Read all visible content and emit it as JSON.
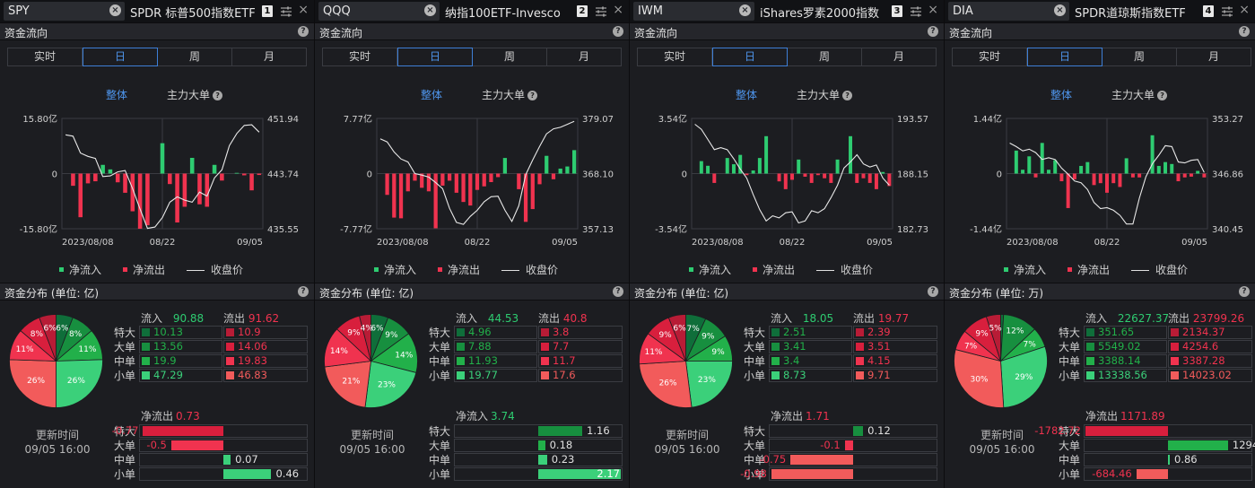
{
  "labels": {
    "section_flow": "资金流向",
    "section_dist_prefix": "资金分布 (单位: ",
    "tabs": [
      "实时",
      "日",
      "周",
      "月"
    ],
    "mode_all": "整体",
    "mode_main": "主力大单",
    "legend_in": "净流入",
    "legend_out": "净流出",
    "legend_close": "收盘价",
    "flow_in": "流入",
    "flow_out": "流出",
    "rows": [
      "特大",
      "大单",
      "中单",
      "小单"
    ],
    "update_time_label": "更新时间",
    "help": "?",
    "close": "×",
    "dates": [
      "2023/08/08",
      "08/22",
      "09/05"
    ]
  },
  "colors": {
    "inflow": "#2ecc71",
    "outflow": "#f0334f",
    "in_shades": [
      "#0f6e3a",
      "#178f3f",
      "#22b04a",
      "#3bd07a"
    ],
    "out_shades": [
      "#b81c36",
      "#d81f3d",
      "#f0334f",
      "#f25b5b"
    ],
    "accent": "#4e95ec"
  },
  "panels": [
    {
      "symbol": "SPY",
      "name": "SPDR 标普500指数ETF",
      "index": "1",
      "unit": "亿",
      "unit_suffix": ")",
      "chart_data": {
        "type": "bar",
        "series": [
          {
            "name": "净流入 / 净流出",
            "values": [
              0,
              -3.5,
              -12.5,
              -2.8,
              -2.2,
              2.5,
              1.2,
              -2.5,
              -5.5,
              -10.8,
              -15.8,
              -14.8,
              0,
              8.7,
              -3.0,
              -14.0,
              -9.5,
              4.5,
              -8.8,
              -9.5,
              2.5,
              -2.0,
              0,
              0.2,
              -0.5,
              -4.8,
              -0.4
            ]
          },
          {
            "name": "收盘价",
            "values": [
              449.5,
              449.3,
              446.8,
              446.3,
              446.0,
              443.3,
              443.4,
              444.0,
              444.2,
              441.5,
              438.5,
              435.6,
              435.8,
              437.2,
              439.5,
              440.3,
              439.8,
              439.5,
              441.0,
              440.4,
              443.1,
              444.3,
              447.9,
              449.7,
              450.9,
              451.0,
              449.9
            ]
          }
        ],
        "y_left": [
          "15.80亿",
          "0",
          "-15.80亿"
        ],
        "y_right": [
          "451.94",
          "443.74",
          "435.55"
        ],
        "y_range": [
          -15.8,
          15.8
        ],
        "price_range": [
          435.55,
          451.94
        ],
        "x_labels": [
          "2023/08/08",
          "08/22",
          "09/05"
        ]
      },
      "flow": {
        "in_total": "90.88",
        "out_total": "91.62",
        "in": [
          "10.13",
          "13.56",
          "19.9",
          "47.29"
        ],
        "out": [
          "10.9",
          "14.06",
          "19.83",
          "46.83"
        ]
      },
      "pie": [
        {
          "label": "6%",
          "value": 6,
          "side": "in",
          "shade": 0
        },
        {
          "label": "8%",
          "value": 8,
          "side": "in",
          "shade": 1
        },
        {
          "label": "11%",
          "value": 11,
          "side": "in",
          "shade": 2
        },
        {
          "label": "26%",
          "value": 26,
          "side": "in",
          "shade": 3
        },
        {
          "label": "26%",
          "value": 26,
          "side": "out",
          "shade": 3
        },
        {
          "label": "11%",
          "value": 11,
          "side": "out",
          "shade": 2
        },
        {
          "label": "8%",
          "value": 8,
          "side": "out",
          "shade": 1
        },
        {
          "label": "6%",
          "value": 6,
          "side": "out",
          "shade": 0
        }
      ],
      "net": {
        "title": "净流出",
        "total": "0.73",
        "dir": "out",
        "values": [
          -0.77,
          -0.5,
          0.07,
          0.46
        ],
        "labels": [
          "-0.77",
          "-0.5",
          "0.07",
          "0.46"
        ],
        "max": 0.8
      },
      "update_time": "09/05 16:00"
    },
    {
      "symbol": "QQQ",
      "name": "纳指100ETF-Invesco",
      "index": "2",
      "unit": "亿",
      "unit_suffix": ")",
      "chart_data": {
        "type": "bar",
        "series": [
          {
            "name": "净流入 / 净流出",
            "values": [
              0,
              -3.0,
              -6.2,
              -6.3,
              -2.5,
              -1.0,
              -2.0,
              -2.5,
              -7.7,
              -1.7,
              -1.0,
              -2.7,
              -4.0,
              -4.5,
              -2.3,
              -1.8,
              -1.2,
              -0.5,
              2.2,
              0,
              -2.2,
              -6.8,
              -5.0,
              -1.5,
              2.5,
              -0.8,
              0.7,
              1.0,
              3.3
            ]
          },
          {
            "name": "收盘价",
            "values": [
              375.0,
              374.4,
              372.4,
              371.0,
              370.4,
              368.1,
              367.8,
              367.4,
              366.3,
              365.1,
              361.2,
              358.4,
              358.0,
              359.6,
              360.8,
              362.5,
              363.5,
              363.6,
              360.8,
              358.6,
              361.7,
              367.9,
              370.8,
              373.5,
              376.0,
              377.0,
              377.3,
              377.9,
              378.5
            ]
          }
        ],
        "y_left": [
          "7.77亿",
          "0",
          "-7.77亿"
        ],
        "y_right": [
          "379.07",
          "368.10",
          "357.13"
        ],
        "y_range": [
          -7.77,
          7.77
        ],
        "price_range": [
          357.13,
          379.07
        ],
        "x_labels": [
          "2023/08/08",
          "08/22",
          "09/05"
        ]
      },
      "flow": {
        "in_total": "44.53",
        "out_total": "40.8",
        "in": [
          "4.96",
          "7.88",
          "11.93",
          "19.77"
        ],
        "out": [
          "3.8",
          "7.7",
          "11.7",
          "17.6"
        ]
      },
      "pie": [
        {
          "label": "6%",
          "value": 6,
          "side": "in",
          "shade": 0
        },
        {
          "label": "9%",
          "value": 9,
          "side": "in",
          "shade": 1
        },
        {
          "label": "14%",
          "value": 14,
          "side": "in",
          "shade": 2
        },
        {
          "label": "23%",
          "value": 23,
          "side": "in",
          "shade": 3
        },
        {
          "label": "21%",
          "value": 21,
          "side": "out",
          "shade": 3
        },
        {
          "label": "14%",
          "value": 14,
          "side": "out",
          "shade": 2
        },
        {
          "label": "9%",
          "value": 9,
          "side": "out",
          "shade": 1
        },
        {
          "label": "4%",
          "value": 4,
          "side": "out",
          "shade": 0
        }
      ],
      "net": {
        "title": "净流入",
        "total": "3.74",
        "dir": "in",
        "values": [
          1.16,
          0.18,
          0.23,
          2.17
        ],
        "labels": [
          "1.16",
          "0.18",
          "0.23",
          "2.17"
        ],
        "max": 2.2
      },
      "update_time": "09/05 16:00"
    },
    {
      "symbol": "IWM",
      "name": "iShares罗素2000指数",
      "index": "3",
      "unit": "亿",
      "unit_suffix": ")",
      "chart_data": {
        "type": "bar",
        "series": [
          {
            "name": "净流入 / 净流出",
            "values": [
              0,
              0.8,
              0.5,
              -0.6,
              0,
              1.0,
              0.6,
              1.2,
              -0.1,
              0.2,
              1.0,
              2.4,
              0,
              -0.5,
              -1.0,
              -0.4,
              0.9,
              -0.2,
              -0.6,
              -0.1,
              -0.3,
              -0.6,
              0.9,
              0,
              2.4,
              -0.6,
              -0.3,
              -0.6,
              -1.0,
              0.1,
              -0.8
            ]
          },
          {
            "name": "收盘价",
            "values": [
              193.0,
              192.5,
              191.5,
              190.5,
              190.7,
              190.5,
              189.6,
              188.6,
              187.7,
              186.1,
              184.6,
              183.5,
              184.0,
              183.8,
              184.3,
              184.4,
              183.3,
              183.5,
              184.5,
              184.3,
              184.7,
              185.8,
              187.0,
              188.7,
              189.3,
              190.0,
              189.1,
              188.8,
              189.0,
              187.7,
              187.0
            ]
          }
        ],
        "y_left": [
          "3.54亿",
          "0",
          "-3.54亿"
        ],
        "y_right": [
          "193.57",
          "188.15",
          "182.73"
        ],
        "y_range": [
          -3.54,
          3.54
        ],
        "price_range": [
          182.73,
          193.57
        ],
        "x_labels": [
          "2023/08/08",
          "08/22",
          "09/05"
        ]
      },
      "flow": {
        "in_total": "18.05",
        "out_total": "19.77",
        "in": [
          "2.51",
          "3.41",
          "3.4",
          "8.73"
        ],
        "out": [
          "2.39",
          "3.51",
          "4.15",
          "9.71"
        ]
      },
      "pie": [
        {
          "label": "7%",
          "value": 7,
          "side": "in",
          "shade": 0
        },
        {
          "label": "9%",
          "value": 9,
          "side": "in",
          "shade": 1
        },
        {
          "label": "9%",
          "value": 9,
          "side": "in",
          "shade": 2
        },
        {
          "label": "23%",
          "value": 23,
          "side": "in",
          "shade": 3
        },
        {
          "label": "26%",
          "value": 26,
          "side": "out",
          "shade": 3
        },
        {
          "label": "11%",
          "value": 11,
          "side": "out",
          "shade": 2
        },
        {
          "label": "9%",
          "value": 9,
          "side": "out",
          "shade": 1
        },
        {
          "label": "6%",
          "value": 6,
          "side": "out",
          "shade": 0
        }
      ],
      "net": {
        "title": "净流出",
        "total": "1.71",
        "dir": "out",
        "values": [
          0.12,
          -0.1,
          -0.75,
          -0.98
        ],
        "labels": [
          "0.12",
          "-0.1",
          "-0.75",
          "-0.98"
        ],
        "max": 1.0
      },
      "update_time": "09/05 16:00"
    },
    {
      "symbol": "DIA",
      "name": "SPDR道琼斯指数ETF",
      "index": "4",
      "unit": "万",
      "unit_suffix": ")",
      "chart_data": {
        "type": "bar",
        "series": [
          {
            "name": "净流入 / 净流出",
            "values": [
              0,
              0.6,
              0.1,
              0.45,
              -0.1,
              0.8,
              0.1,
              0.35,
              -0.2,
              -0.9,
              -0.15,
              0.2,
              0.3,
              -0.3,
              -0.25,
              -0.5,
              -0.25,
              -0.35,
              0.4,
              -0.1,
              -0.1,
              0,
              1.0,
              0.2,
              0.3,
              0.25,
              -0.2,
              -0.1,
              -0.08,
              0.07,
              -0.1
            ]
          },
          {
            "name": "收盘价",
            "values": [
              350.4,
              350.0,
              349.5,
              349.7,
              349.3,
              348.5,
              348.7,
              348.5,
              347.5,
              346.8,
              346.0,
              345.8,
              345.0,
              343.5,
              342.8,
              342.9,
              342.6,
              342.0,
              341.0,
              341.0,
              344.0,
              346.5,
              348.0,
              349.0,
              350.1,
              350.0,
              348.2,
              348.1,
              348.4,
              348.5,
              347.0
            ]
          }
        ],
        "y_left": [
          "1.44亿",
          "0",
          "-1.44亿"
        ],
        "y_right": [
          "353.27",
          "346.86",
          "340.45"
        ],
        "y_range": [
          -1.44,
          1.44
        ],
        "price_range": [
          340.45,
          353.27
        ],
        "x_labels": [
          "2023/08/08",
          "08/22",
          "09/05"
        ]
      },
      "flow": {
        "in_total": "22627.37",
        "out_total": "23799.26",
        "in": [
          "351.65",
          "5549.02",
          "3388.14",
          "13338.56"
        ],
        "out": [
          "2134.37",
          "4254.6",
          "3387.28",
          "14023.02"
        ]
      },
      "pie": [
        {
          "label": "1%",
          "value": 1,
          "side": "in",
          "shade": 0
        },
        {
          "label": "12%",
          "value": 12,
          "side": "in",
          "shade": 1
        },
        {
          "label": "7%",
          "value": 7,
          "side": "in",
          "shade": 2
        },
        {
          "label": "29%",
          "value": 29,
          "side": "in",
          "shade": 3
        },
        {
          "label": "30%",
          "value": 30,
          "side": "out",
          "shade": 3
        },
        {
          "label": "7%",
          "value": 7,
          "side": "out",
          "shade": 2
        },
        {
          "label": "9%",
          "value": 9,
          "side": "out",
          "shade": 1
        },
        {
          "label": "5%",
          "value": 5,
          "side": "out",
          "shade": 0
        }
      ],
      "net": {
        "title": "净流出",
        "total": "1171.89",
        "dir": "out",
        "values": [
          -1782.72,
          1294.42,
          0.86,
          -684.46
        ],
        "labels": [
          "-1782.72",
          "1294.42",
          "0.86",
          "-684.46"
        ],
        "max": 1800
      },
      "update_time": "09/05 16:00"
    }
  ]
}
